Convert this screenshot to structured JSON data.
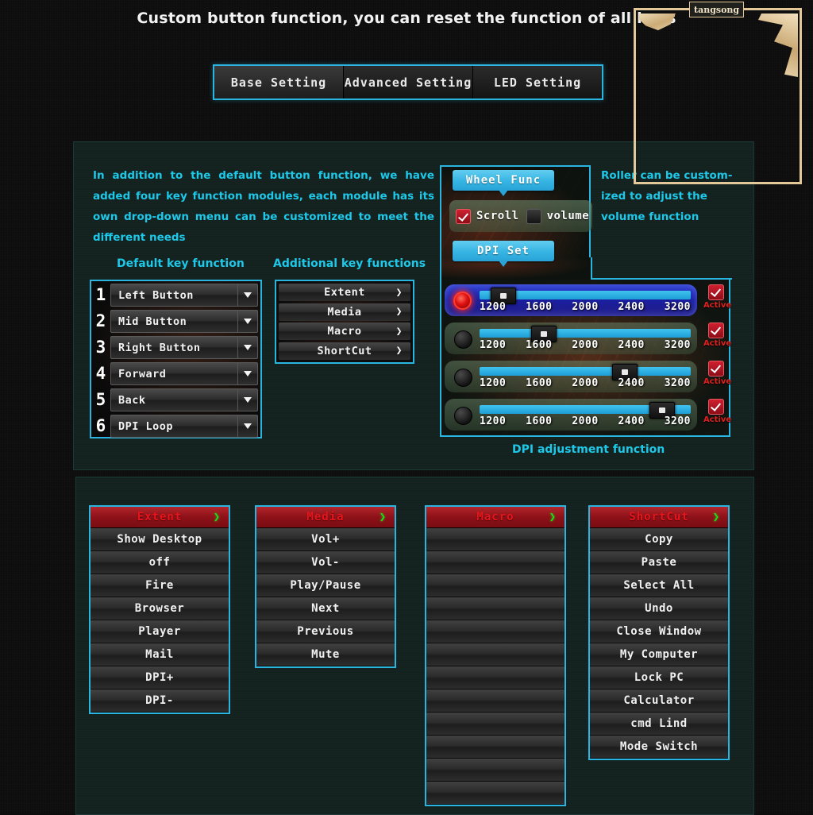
{
  "headline": "Custom button function, you can reset the function of all keys",
  "tabs": [
    {
      "label": "Base Setting",
      "active": true
    },
    {
      "label": "Advanced Setting",
      "active": false
    },
    {
      "label": "LED Setting",
      "active": false
    }
  ],
  "blurb": "In addition to the default button function, we have added  four key function modules, each  module  has  its  own  drop-down menu can be customized to meet the different needs",
  "roller_note": "Roller can be custom-ized to adjust the volume function",
  "default_keys": {
    "title": "Default key function",
    "rows": [
      {
        "num": "1",
        "value": "Left Button"
      },
      {
        "num": "2",
        "value": "Mid Button"
      },
      {
        "num": "3",
        "value": "Right Button"
      },
      {
        "num": "4",
        "value": "Forward"
      },
      {
        "num": "5",
        "value": "Back"
      },
      {
        "num": "6",
        "value": "DPI Loop"
      }
    ]
  },
  "additional_keys": {
    "title": "Additional key functions",
    "chevron": "❯",
    "rows": [
      {
        "label": "Extent"
      },
      {
        "label": "Media"
      },
      {
        "label": "Macro"
      },
      {
        "label": "ShortCut"
      }
    ]
  },
  "wheel": {
    "tag": "Wheel Func",
    "scroll_label": "Scroll",
    "volume_label": "volume",
    "scroll_checked": true,
    "volume_checked": false
  },
  "dpi": {
    "tag": "DPI Set",
    "caption": "DPI adjustment function",
    "active_label": "Active",
    "ticks": [
      "1200",
      "1600",
      "2000",
      "2400",
      "3200"
    ],
    "rows": [
      {
        "selected": true,
        "value": 1200,
        "active": true
      },
      {
        "selected": false,
        "value": 1600,
        "active": true
      },
      {
        "selected": false,
        "value": 2400,
        "active": true
      },
      {
        "selected": false,
        "value": 3200,
        "active": true
      }
    ]
  },
  "menus": [
    {
      "title": "Extent",
      "chevron": "❯",
      "items": [
        "Show Desktop",
        "off",
        "Fire",
        "Browser",
        "Player",
        "Mail",
        "DPI+",
        "DPI-"
      ]
    },
    {
      "title": "Media",
      "chevron": "❯",
      "items": [
        "Vol+",
        "Vol-",
        "Play/Pause",
        "Next",
        "Previous",
        "Mute"
      ]
    },
    {
      "title": "Macro",
      "chevron": "❯",
      "items": [
        "",
        "",
        "",
        "",
        "",
        "",
        "",
        "",
        "",
        "",
        "",
        ""
      ]
    },
    {
      "title": "ShortCut",
      "chevron": "❯",
      "items": [
        "Copy",
        "Paste",
        "Select All",
        "Undo",
        "Close Window",
        "My Computer",
        "Lock PC",
        "Calculator",
        "cmd Lind",
        "Mode Switch"
      ]
    }
  ],
  "watermark": {
    "text": "tangsong"
  },
  "colors": {
    "accent": "#2ab4e0",
    "text_cyan": "#1ec8e8",
    "red": "#e8161b",
    "green": "#19e019",
    "frame": "#e3c89a"
  }
}
